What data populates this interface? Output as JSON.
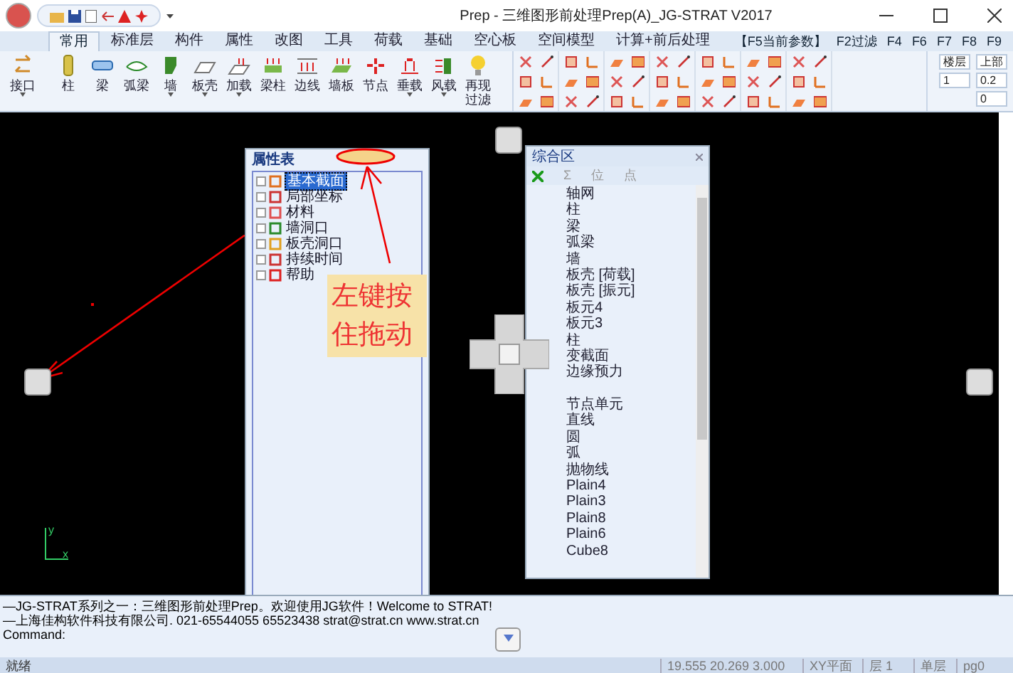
{
  "window": {
    "title": "Prep - 三维图形前处理Prep(A)_JG-STRAT V2017"
  },
  "tabs": [
    {
      "label": "常用",
      "selected": true
    },
    {
      "label": "标准层",
      "selected": false
    },
    {
      "label": "构件",
      "selected": false
    },
    {
      "label": "属性",
      "selected": false
    },
    {
      "label": "改图",
      "selected": false
    },
    {
      "label": "工具",
      "selected": false
    },
    {
      "label": "荷载",
      "selected": false
    },
    {
      "label": "基础",
      "selected": false
    },
    {
      "label": "空心板",
      "selected": false
    },
    {
      "label": "空间模型",
      "selected": false
    },
    {
      "label": "计算+前后处理",
      "selected": false
    }
  ],
  "function_keys": [
    "【F5当前参数】",
    "F2过滤",
    "F4",
    "F6",
    "F7",
    "F8",
    "F9"
  ],
  "ribbon_buttons": [
    {
      "label": "接口",
      "dropdown": true
    },
    {
      "label": "柱",
      "dropdown": false
    },
    {
      "label": "梁",
      "dropdown": false
    },
    {
      "label": "弧梁",
      "dropdown": false
    },
    {
      "label": "墙",
      "dropdown": true
    },
    {
      "label": "板壳",
      "dropdown": true
    },
    {
      "label": "加载",
      "dropdown": true
    },
    {
      "label": "梁柱",
      "dropdown": false
    },
    {
      "label": "边线",
      "dropdown": false
    },
    {
      "label": "墙板",
      "dropdown": false
    },
    {
      "label": "节点",
      "dropdown": false
    },
    {
      "label": "垂载",
      "dropdown": true
    },
    {
      "label": "风载",
      "dropdown": true
    },
    {
      "label": "再现过滤",
      "dropdown": false
    }
  ],
  "ribbon_fields": [
    {
      "value": "楼层"
    },
    {
      "value": "1"
    },
    {
      "value": "上部"
    },
    {
      "value": "0.2"
    },
    {
      "value": "0"
    }
  ],
  "property_panel": {
    "title": "属性表",
    "items": [
      {
        "label": "基本截面",
        "selected": true
      },
      {
        "label": "局部坐标",
        "selected": false
      },
      {
        "label": "材料",
        "selected": false
      },
      {
        "label": "墙洞口",
        "selected": false
      },
      {
        "label": "板壳洞口",
        "selected": false
      },
      {
        "label": "持续时间",
        "selected": false
      },
      {
        "label": "帮助",
        "selected": false
      }
    ]
  },
  "annotation": {
    "note": "左键按住拖动"
  },
  "result_panel": {
    "title": "综合区",
    "toolbar": [
      "Σ",
      "位",
      "点"
    ],
    "groups": [
      {
        "items": [
          "轴网",
          "柱",
          "梁",
          "弧梁",
          "墙",
          "板壳 [荷载]",
          "板壳 [振元]",
          "板元4",
          "板元3",
          "柱",
          "变截面",
          "边缘预力"
        ]
      },
      {
        "items": [
          "节点单元",
          "直线",
          "圆",
          "弧",
          "抛物线",
          "Plain4",
          "Plain3",
          "Plain8",
          "Plain6",
          "Cube8"
        ]
      }
    ]
  },
  "axes": {
    "y": "y",
    "x": "x"
  },
  "command": {
    "lines": [
      "—JG-STRAT系列之一：三维图形前处理Prep。欢迎使用JG软件！Welcome to STRAT!",
      "—上海佳构软件科技有限公司.  021-65544055 65523438 strat@strat.cn  www.strat.cn"
    ],
    "prompt": "Command:"
  },
  "status_bar": {
    "message": "就绪",
    "fields": [
      "19.555 20.269 3.000",
      "XY平面",
      "层 1",
      "单层",
      "pg0"
    ]
  }
}
